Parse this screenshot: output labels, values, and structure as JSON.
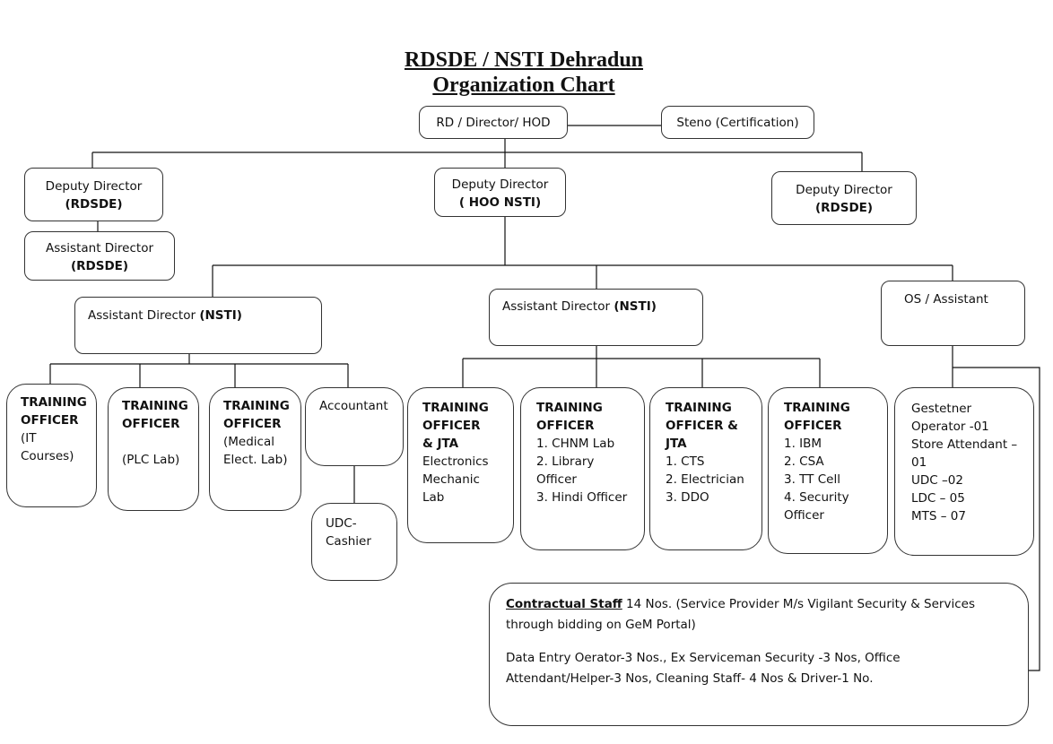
{
  "title": {
    "line1": "RDSDE / NSTI Dehradun",
    "line2": "Organization Chart"
  },
  "top": {
    "head": "RD / Director/ HOD",
    "steno": "Steno (Certification)"
  },
  "deputies": {
    "left": {
      "role": "Deputy Director",
      "unit": "(RDSDE)"
    },
    "center": {
      "role": "Deputy Director",
      "unit": "( HOO NSTI)"
    },
    "right": {
      "role": "Deputy Director",
      "unit": "(RDSDE)"
    }
  },
  "assistant_rdsde": {
    "role": "Assistant Director",
    "unit": "(RDSDE)"
  },
  "assistants": {
    "left": {
      "role": "Assistant Director ",
      "unit": "(NSTI)"
    },
    "center": {
      "role": "Assistant Director ",
      "unit": "(NSTI)"
    },
    "right": {
      "role": "OS / Assistant"
    }
  },
  "units": {
    "it": {
      "title1": "TRAINING",
      "title2": "OFFICER",
      "lines": [
        "(IT",
        "Courses)"
      ]
    },
    "plc": {
      "title1": "TRAINING",
      "title2": "OFFICER",
      "lines": [
        "",
        "(PLC Lab)"
      ]
    },
    "medical": {
      "title1": "TRAINING",
      "title2": "OFFICER",
      "lines": [
        "(Medical",
        "Elect. Lab)"
      ]
    },
    "accountant": {
      "label": "Accountant"
    },
    "cashier": {
      "line1": "UDC-",
      "line2": "Cashier"
    },
    "electronics": {
      "title1": "TRAINING",
      "title2": "OFFICER",
      "title3": "& JTA",
      "lines": [
        "Electronics",
        "Mechanic",
        "Lab"
      ]
    },
    "chnm": {
      "title1": "TRAINING",
      "title2": "OFFICER",
      "lines": [
        "1. CHNM Lab",
        "2. Library",
        "Officer",
        "3. Hindi Officer"
      ]
    },
    "cts": {
      "title1": "TRAINING",
      "title2": "OFFICER &",
      "title3": "JTA",
      "lines": [
        "1. CTS",
        "2. Electrician",
        "3. DDO"
      ]
    },
    "ibm": {
      "title1": "TRAINING",
      "title2": "OFFICER",
      "lines": [
        "1. IBM",
        "2. CSA",
        "3. TT Cell",
        "4. Security",
        "Officer"
      ]
    },
    "staff": {
      "lines": [
        "Gestetner",
        "Operator -01",
        "Store Attendant –",
        "01",
        "UDC –02",
        "LDC – 05",
        "MTS – 07"
      ]
    }
  },
  "contractual": {
    "heading": "Contractual Staff",
    "intro": " 14 Nos. (Service Provider M/s Vigilant Security & Services through bidding on GeM Portal)",
    "details": "Data Entry Oerator-3 Nos., Ex Serviceman Security -3 Nos, Office Attendant/Helper-3 Nos, Cleaning Staff- 4 Nos & Driver-1 No."
  }
}
